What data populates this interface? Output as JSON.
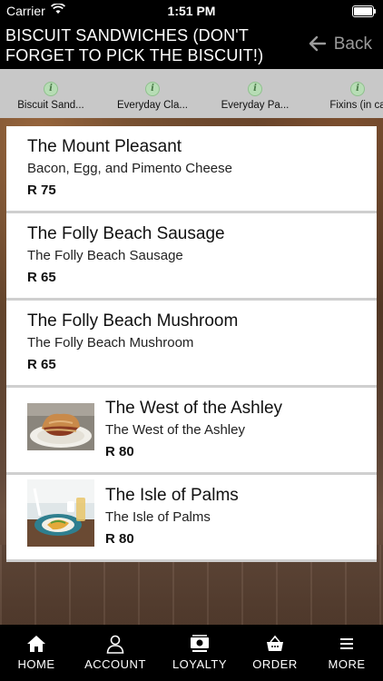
{
  "status_bar": {
    "carrier": "Carrier",
    "time": "1:51 PM",
    "wifi_icon": "wifi-icon",
    "battery_icon": "battery-icon"
  },
  "header": {
    "title_line1": "BISCUIT SANDWICHES (DON'T",
    "title_line2": "FORGET TO PICK THE BISCUIT!)",
    "back_label": "Back",
    "back_icon": "arrow-left-icon"
  },
  "category_tabs": [
    {
      "label": "Biscuit Sand...",
      "icon": "info-icon"
    },
    {
      "label": "Everyday Cla...",
      "icon": "info-icon"
    },
    {
      "label": "Everyday Pa...",
      "icon": "info-icon"
    },
    {
      "label": "Fixins (in ca",
      "icon": "info-icon"
    }
  ],
  "menu_items": [
    {
      "name": "The Mount Pleasant",
      "description": "Bacon, Egg, and Pimento Cheese",
      "price": "R 75"
    },
    {
      "name": "The Folly Beach Sausage",
      "description": "The Folly Beach Sausage",
      "price": "R 65"
    },
    {
      "name": "The Folly Beach Mushroom",
      "description": "The Folly Beach Mushroom",
      "price": "R 65"
    },
    {
      "name": "The West of the Ashley",
      "description": "The West of the Ashley",
      "price": "R 80"
    },
    {
      "name": "The Isle of Palms",
      "description": "The Isle of Palms",
      "price": "R 80"
    }
  ],
  "bottom_nav": [
    {
      "label": "HOME",
      "icon": "home-icon"
    },
    {
      "label": "ACCOUNT",
      "icon": "user-icon"
    },
    {
      "label": "LOYALTY",
      "icon": "money-icon"
    },
    {
      "label": "ORDER",
      "icon": "basket-icon"
    },
    {
      "label": "MORE",
      "icon": "menu-icon"
    }
  ],
  "colors": {
    "bar_background": "#000000",
    "tabs_background": "#c8c8c8",
    "info_icon": "#b7ddb5",
    "card_background": "#ffffff"
  }
}
